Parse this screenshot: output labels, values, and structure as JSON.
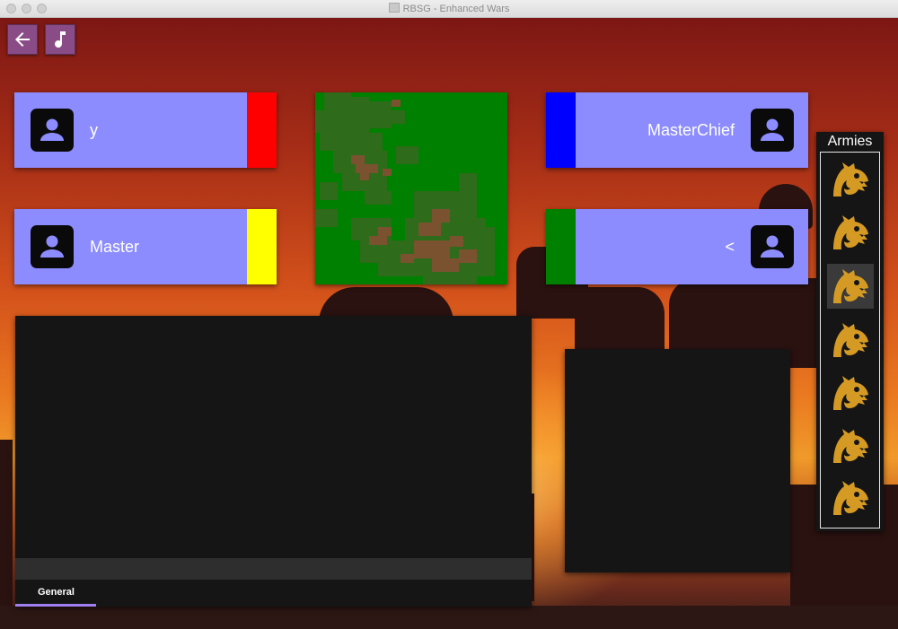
{
  "window": {
    "title": "RBSG - Enhanced Wars"
  },
  "toolbar": {
    "back_icon": "arrow-left-icon",
    "music_icon": "music-note-icon"
  },
  "players": [
    {
      "name": "y",
      "color": "#ff0000",
      "side": "left"
    },
    {
      "name": "Master",
      "color": "#ffff00",
      "side": "left"
    },
    {
      "name": "MasterChief",
      "color": "#0000ff",
      "side": "right"
    },
    {
      "name": "<",
      "color": "#008000",
      "side": "right"
    }
  ],
  "map": {
    "land_color": "#008000",
    "forest_color": "#2e6b1a",
    "mountain_color": "#7a5230"
  },
  "chat": {
    "input_value": "",
    "tabs": [
      {
        "label": "General",
        "active": true
      }
    ]
  },
  "armies": {
    "title": "Armies",
    "items": [
      {
        "icon": "dragon-icon",
        "selected": false
      },
      {
        "icon": "dragon-icon",
        "selected": false
      },
      {
        "icon": "dragon-icon",
        "selected": true
      },
      {
        "icon": "dragon-icon",
        "selected": false
      },
      {
        "icon": "dragon-icon",
        "selected": false
      },
      {
        "icon": "dragon-icon",
        "selected": false
      },
      {
        "icon": "dragon-icon",
        "selected": false
      }
    ]
  },
  "colors": {
    "card_bg": "#8c8cff",
    "panel_bg": "#151515",
    "accent": "#a07ff0",
    "button_bg": "#8a4c86",
    "dragon": "#d49a24"
  }
}
